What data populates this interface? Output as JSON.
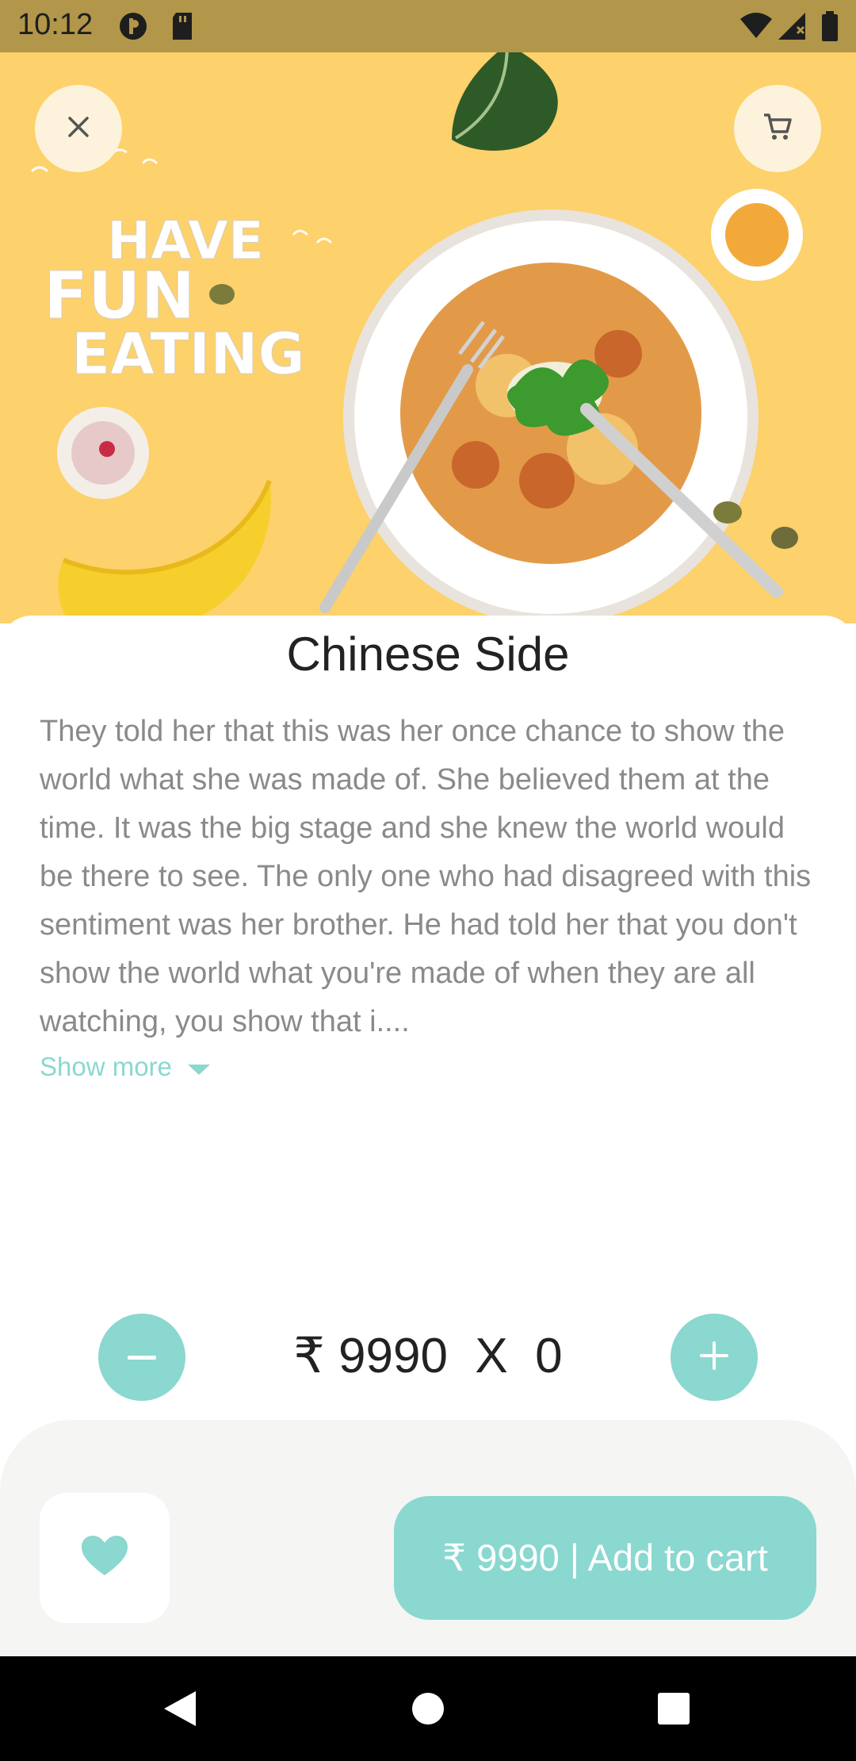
{
  "status_bar": {
    "time": "10:12"
  },
  "hero": {
    "close_icon": "close-icon",
    "cart_icon": "shopping-cart-icon",
    "banner_text_line1": "HAVE",
    "banner_text_line2": "FUN",
    "banner_text_line3": "EATING"
  },
  "product": {
    "title": "Chinese Side",
    "description": "They told her that this was her once chance to show the world what she was made of. She believed them at the time. It was the big stage and she knew the world would be there to see. The only one who had disagreed with this sentiment was her brother. He had told her that you don't show the world what you're made of when they are all watching, you show that i....",
    "show_more_label": "Show more"
  },
  "quantity": {
    "price_qty_text": "₹ 9990  X  0"
  },
  "bottom": {
    "add_to_cart_label": "₹ 9990 | Add to cart"
  },
  "colors": {
    "accent": "#8ad8cf",
    "hero_background": "#fdd16b",
    "status_bar": "#b2964a"
  }
}
